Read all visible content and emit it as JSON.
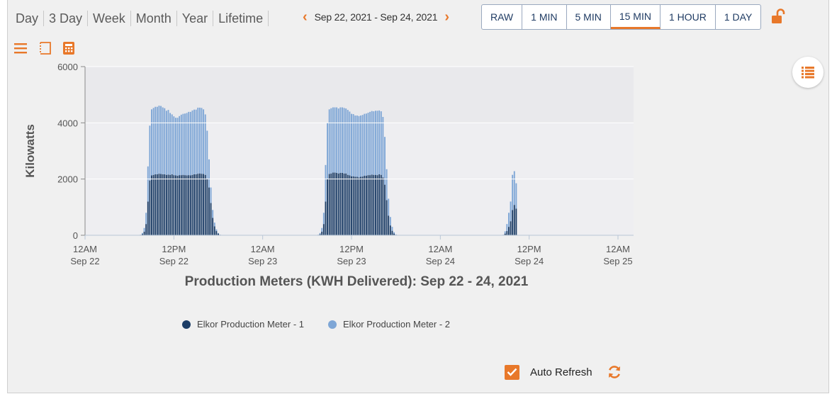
{
  "toolbar": {
    "ranges": [
      "Day",
      "3 Day",
      "Week",
      "Month",
      "Year",
      "Lifetime"
    ],
    "date_range": "Sep 22, 2021 - Sep 24, 2021",
    "intervals": [
      "RAW",
      "1 MIN",
      "5 MIN",
      "15 MIN",
      "1 HOUR",
      "1 DAY"
    ],
    "active_interval": "15 MIN"
  },
  "tools": [
    "menu-icon",
    "select-zoom-icon",
    "calculator-icon"
  ],
  "chart_data": {
    "type": "bar",
    "stacked": true,
    "title": "Production Meters (KWH Delivered): Sep 22 - 24, 2021",
    "ylabel": "Kilowatts",
    "ylim": [
      0,
      6000
    ],
    "yticks": [
      0,
      2000,
      4000,
      6000
    ],
    "xlim": [
      "2021-09-22T00:00",
      "2021-09-25T00:00"
    ],
    "xticks": [
      {
        "time": "2021-09-22T00:00",
        "label1": "12AM",
        "label2": "Sep 22"
      },
      {
        "time": "2021-09-22T12:00",
        "label1": "12PM",
        "label2": "Sep 22"
      },
      {
        "time": "2021-09-23T00:00",
        "label1": "12AM",
        "label2": "Sep 23"
      },
      {
        "time": "2021-09-23T12:00",
        "label1": "12PM",
        "label2": "Sep 23"
      },
      {
        "time": "2021-09-24T00:00",
        "label1": "12AM",
        "label2": "Sep 24"
      },
      {
        "time": "2021-09-24T12:00",
        "label1": "12PM",
        "label2": "Sep 24"
      },
      {
        "time": "2021-09-25T00:00",
        "label1": "12AM",
        "label2": "Sep 25"
      }
    ],
    "interval_minutes": 15,
    "series": [
      {
        "name": "Elkor Production Meter - 1",
        "color": "#1c3d66",
        "segments": [
          {
            "start": "2021-09-22T07:30",
            "values": [
              10,
              40,
              130,
              400,
              1200,
              1950,
              2130,
              2150,
              2170,
              2170,
              2190,
              2180,
              2170,
              2170,
              2150,
              2160,
              2150,
              2170,
              2140,
              2130,
              2120,
              2140,
              2140,
              2150,
              2140,
              2130,
              2140,
              2130,
              2150,
              2170,
              2170,
              2190,
              2200,
              2190,
              2180,
              2150,
              2020,
              1700,
              1150,
              620,
              320,
              150,
              60,
              15
            ]
          },
          {
            "start": "2021-09-23T07:30",
            "values": [
              10,
              40,
              130,
              400,
              1200,
              2000,
              2180,
              2200,
              2230,
              2230,
              2220,
              2200,
              2220,
              2220,
              2200,
              2200,
              2150,
              2130,
              2100,
              2100,
              2080,
              2080,
              2060,
              2080,
              2090,
              2120,
              2120,
              2140,
              2140,
              2160,
              2150,
              2150,
              2140,
              2170,
              2150,
              2060,
              1800,
              1250,
              700,
              350,
              160,
              60,
              15
            ]
          },
          {
            "start": "2021-09-24T08:30",
            "values": [
              10,
              60,
              150,
              300,
              500,
              900,
              1080,
              950
            ]
          }
        ]
      },
      {
        "name": "Elkor Production Meter - 2",
        "color": "#7ea6d6",
        "segments": [
          {
            "start": "2021-09-22T07:30",
            "values": [
              10,
              40,
              130,
              400,
              1250,
              1950,
              2350,
              2380,
              2400,
              2400,
              2420,
              2420,
              2380,
              2350,
              2280,
              2300,
              2200,
              2130,
              2090,
              2050,
              2060,
              2100,
              2150,
              2170,
              2190,
              2220,
              2250,
              2260,
              2290,
              2300,
              2300,
              2350,
              2340,
              2340,
              2300,
              2150,
              1700,
              1000,
              550,
              280,
              130,
              60,
              20,
              5
            ]
          },
          {
            "start": "2021-09-23T07:30",
            "values": [
              10,
              40,
              130,
              400,
              1300,
              2000,
              2300,
              2320,
              2320,
              2320,
              2330,
              2310,
              2330,
              2330,
              2330,
              2310,
              2310,
              2270,
              2220,
              2210,
              2180,
              2180,
              2180,
              2180,
              2190,
              2200,
              2210,
              2220,
              2250,
              2260,
              2260,
              2280,
              2290,
              2270,
              2260,
              2150,
              1700,
              1100,
              600,
              300,
              140,
              50,
              15
            ]
          },
          {
            "start": "2021-09-24T08:30",
            "values": [
              10,
              80,
              250,
              500,
              700,
              1250,
              1200,
              900
            ]
          }
        ]
      }
    ],
    "legend": {
      "position": "bottom-center"
    }
  },
  "footer": {
    "auto_refresh_label": "Auto Refresh",
    "auto_refresh_checked": true
  },
  "colors": {
    "accent": "#e8782a",
    "meter1": "#1c3d66",
    "meter2": "#7ea6d6",
    "interval_text": "#1f3b63"
  }
}
